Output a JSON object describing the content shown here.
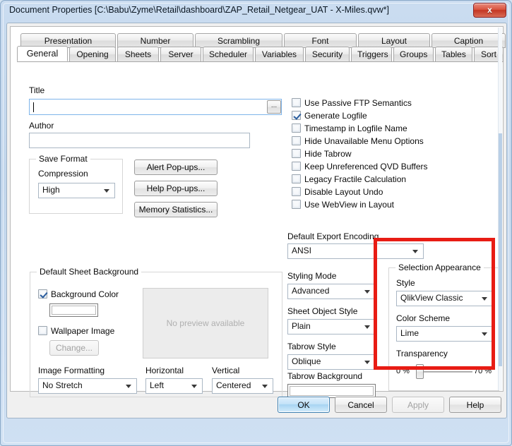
{
  "window": {
    "title": "Document Properties [C:\\Babu\\Zyme\\Retail\\dashboard\\ZAP_Retail_Netgear_UAT - X-Miles.qvw*]",
    "close_label": "x"
  },
  "tabs": {
    "row1": [
      {
        "label": "Presentation"
      },
      {
        "label": "Number"
      },
      {
        "label": "Scrambling"
      },
      {
        "label": "Font"
      },
      {
        "label": "Layout"
      },
      {
        "label": "Caption"
      }
    ],
    "row2": [
      {
        "label": "General"
      },
      {
        "label": "Opening"
      },
      {
        "label": "Sheets"
      },
      {
        "label": "Server"
      },
      {
        "label": "Scheduler"
      },
      {
        "label": "Variables"
      },
      {
        "label": "Security"
      },
      {
        "label": "Triggers"
      },
      {
        "label": "Groups"
      },
      {
        "label": "Tables"
      },
      {
        "label": "Sort"
      }
    ],
    "selected": "General"
  },
  "general": {
    "title_label": "Title",
    "title_value": "",
    "title_browse_label": "...",
    "author_label": "Author",
    "author_value": "",
    "save_format": {
      "group_label": "Save Format",
      "compression_label": "Compression",
      "compression_value": "High"
    },
    "buttons": {
      "alert_popups": "Alert Pop-ups...",
      "help_popups": "Help Pop-ups...",
      "memory_statistics": "Memory Statistics..."
    },
    "checkboxes": [
      {
        "label": "Use Passive FTP Semantics",
        "checked": false
      },
      {
        "label": "Generate Logfile",
        "checked": true
      },
      {
        "label": "Timestamp in Logfile Name",
        "checked": false
      },
      {
        "label": "Hide Unavailable Menu Options",
        "checked": false
      },
      {
        "label": "Hide Tabrow",
        "checked": false
      },
      {
        "label": "Keep Unreferenced QVD Buffers",
        "checked": false
      },
      {
        "label": "Legacy Fractile Calculation",
        "checked": false
      },
      {
        "label": "Disable Layout Undo",
        "checked": false
      },
      {
        "label": "Use WebView in Layout",
        "checked": false
      }
    ],
    "export_encoding": {
      "label": "Default Export Encoding",
      "value": "ANSI"
    },
    "sheet_background": {
      "group_label": "Default Sheet Background",
      "background_color_label": "Background Color",
      "background_color_checked": true,
      "background_color_value": "#ffffff",
      "wallpaper_image_label": "Wallpaper Image",
      "wallpaper_image_checked": false,
      "change_button_label": "Change...",
      "preview_text": "No preview available",
      "image_formatting_label": "Image Formatting",
      "image_formatting_value": "No Stretch",
      "horizontal_label": "Horizontal",
      "horizontal_value": "Left",
      "vertical_label": "Vertical",
      "vertical_value": "Centered"
    },
    "styling": {
      "styling_mode_label": "Styling Mode",
      "styling_mode_value": "Advanced",
      "sheet_object_style_label": "Sheet Object Style",
      "sheet_object_style_value": "Plain",
      "tabrow_style_label": "Tabrow Style",
      "tabrow_style_value": "Oblique",
      "tabrow_background_label": "Tabrow Background",
      "tabrow_background_value": ""
    },
    "selection_appearance": {
      "group_label": "Selection Appearance",
      "style_label": "Style",
      "style_value": "QlikView Classic",
      "color_scheme_label": "Color Scheme",
      "color_scheme_value": "Lime",
      "transparency_label": "Transparency",
      "transparency_min": "0 %",
      "transparency_max": "70 %",
      "transparency_position_pct": 8,
      "highlight_color": "#e81c14"
    }
  },
  "footer": {
    "ok": "OK",
    "cancel": "Cancel",
    "apply": "Apply",
    "help": "Help"
  }
}
